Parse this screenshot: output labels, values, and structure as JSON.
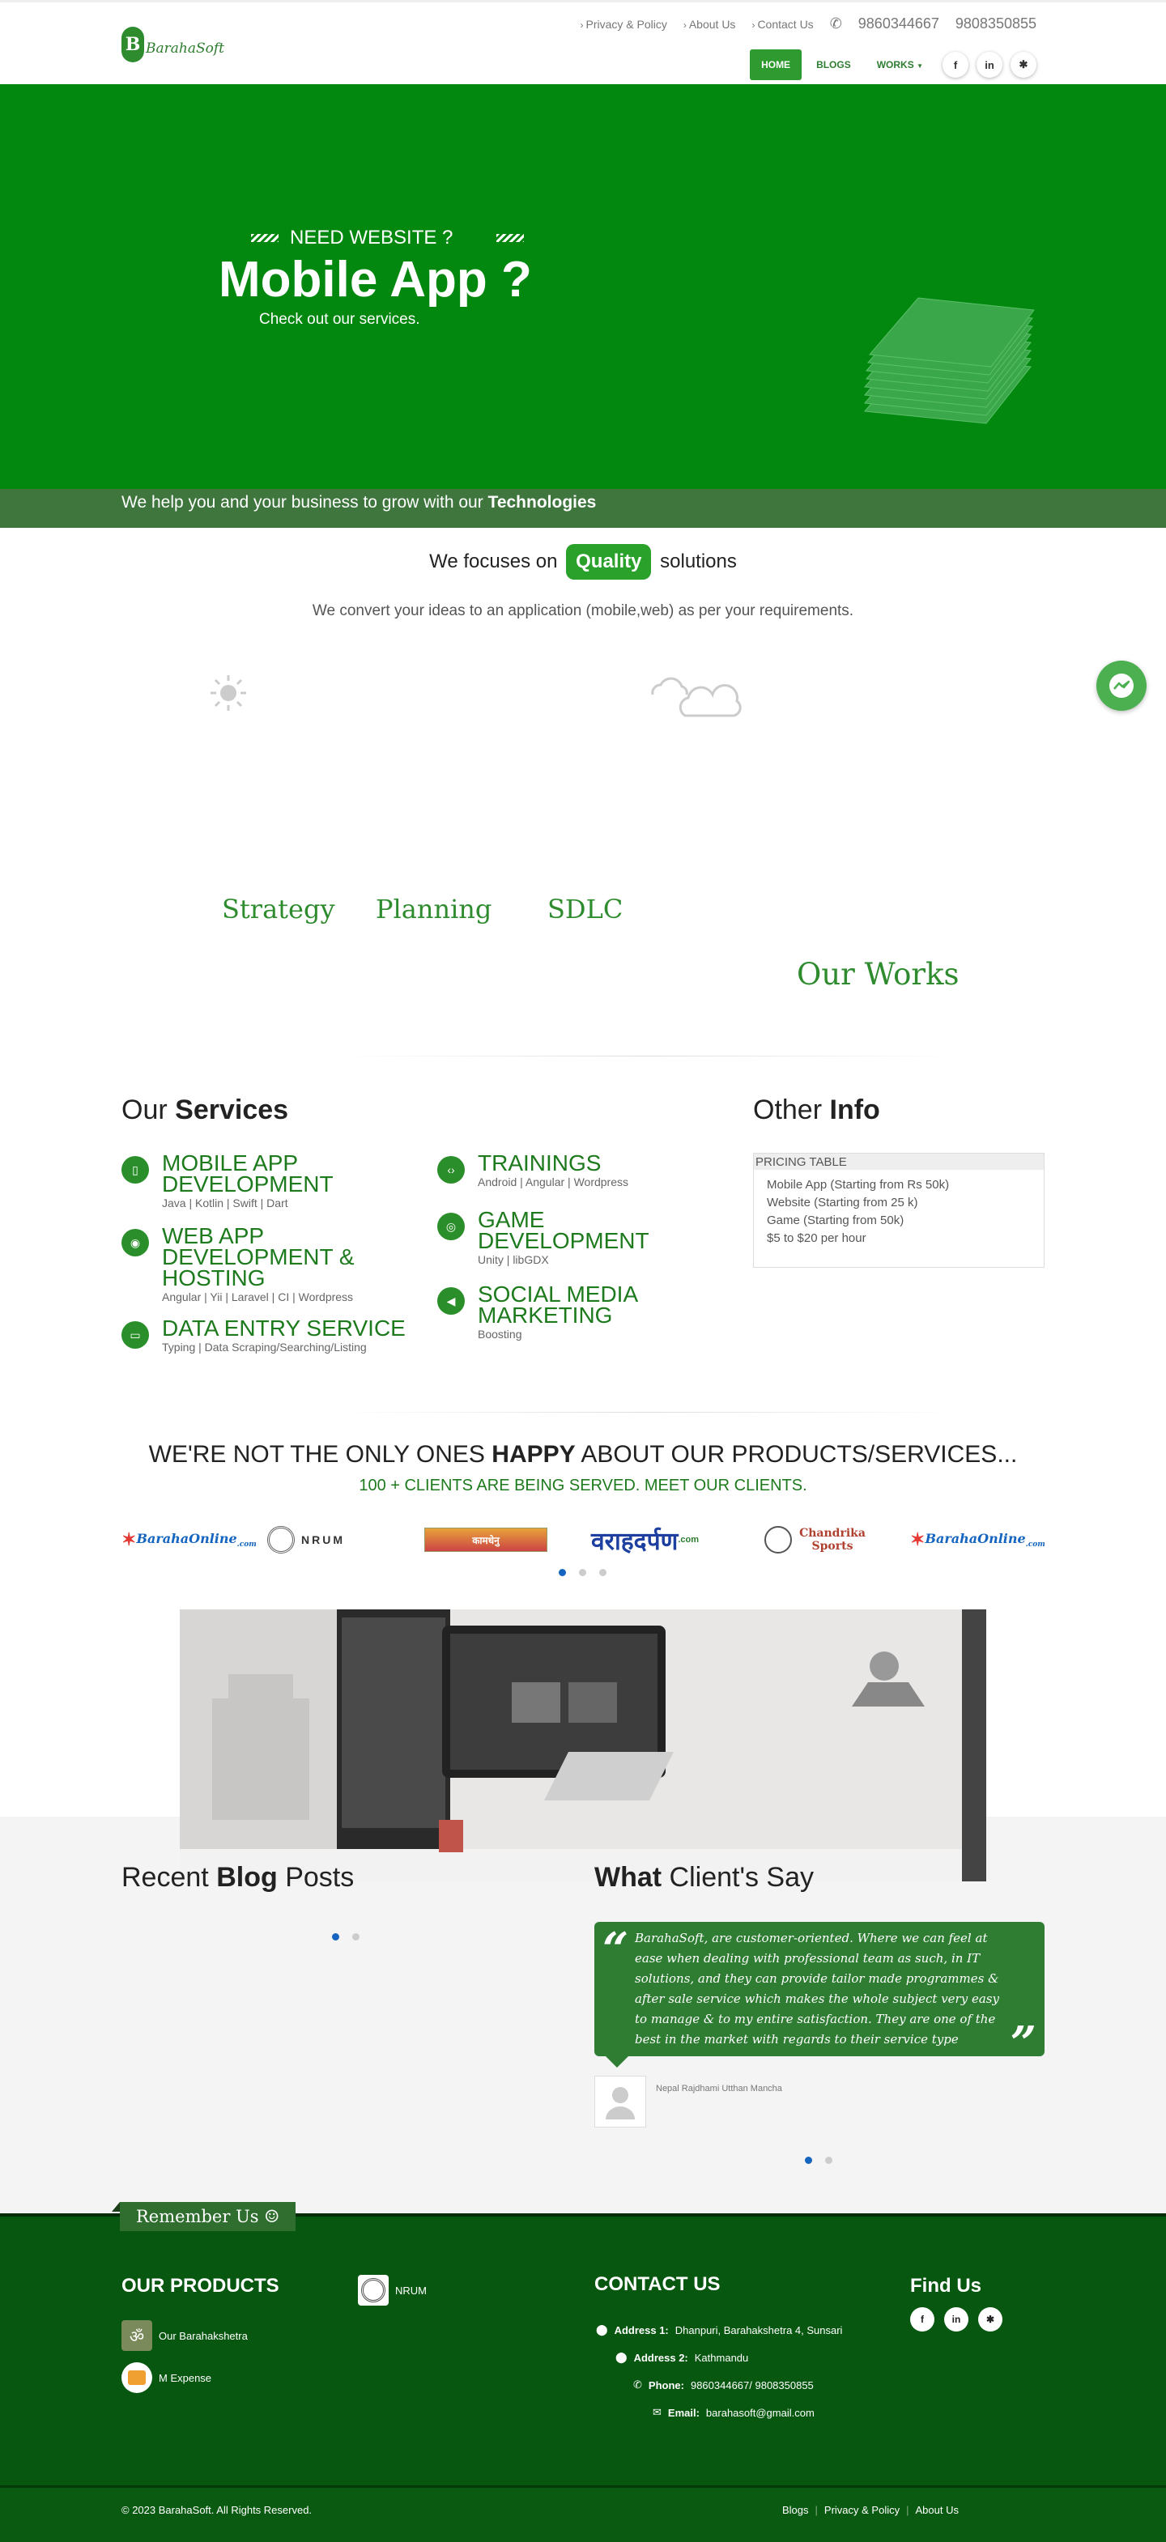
{
  "header": {
    "logo_text": "BarahaSoft",
    "logo_mark": "B",
    "top_links": [
      "Privacy & Policy",
      "About Us",
      "Contact Us"
    ],
    "phones": [
      "9860344667",
      "9808350855"
    ],
    "nav": [
      "HOME",
      "BLOGS",
      "WORKS"
    ],
    "social_icons": [
      "facebook-icon",
      "linkedin-icon",
      "android-icon"
    ],
    "social_glyphs": [
      "f",
      "in",
      "✱"
    ]
  },
  "hero": {
    "kicker": "NEED WEBSITE ?",
    "title": "Mobile App ?",
    "subtitle": "Check out our services.",
    "tagline_prefix": "We help you and your business to grow with our",
    "tagline_bold": "Technologies"
  },
  "intro": {
    "focus_prefix": "We focuses on",
    "focus_badge": "Quality",
    "focus_suffix": "solutions",
    "convert": "We convert your ideas to an application (mobile,web) as per your requirements.",
    "words": [
      "Strategy",
      "Planning",
      "SDLC"
    ],
    "our_works": "Our Works"
  },
  "services": {
    "title_light": "Our",
    "title_bold": "Services",
    "items": [
      {
        "title": "MOBILE APP DEVELOPMENT",
        "sub": "Java | Kotlin | Swift | Dart",
        "icon": "▯"
      },
      {
        "title": "WEB APP DEVELOPMENT & HOSTING",
        "sub": "Angular | Yii | Laravel | CI | Wordpress",
        "icon": "◉"
      },
      {
        "title": "DATA ENTRY SERVICE",
        "sub": "Typing | Data Scraping/Searching/Listing",
        "icon": "▭"
      },
      {
        "title": "TRAININGS",
        "sub": "Android | Angular | Wordpress",
        "icon": "‹›"
      },
      {
        "title": "GAME DEVELOPMENT",
        "sub": "Unity | libGDX",
        "icon": "◎"
      },
      {
        "title": "SOCIAL MEDIA MARKETING",
        "sub": "Boosting",
        "icon": "◀"
      }
    ]
  },
  "other_info": {
    "title_light": "Other",
    "title_bold": "Info",
    "pricing_head": "PRICING TABLE",
    "pricing": [
      "Mobile App (Starting from Rs 50k)",
      "Website (Starting from 25 k)",
      "Game (Starting from 50k)",
      "$5 to $20 per hour"
    ]
  },
  "clients": {
    "heading_prefix": "WE'RE NOT THE ONLY ONES",
    "heading_bold": "HAPPY",
    "heading_suffix": "ABOUT OUR PRODUCTS/SERVICES...",
    "sub": "100 + CLIENTS ARE BEING SERVED. MEET OUR CLIENTS.",
    "logos": [
      "BarahaOnline",
      "NRUM",
      "कामधेनु",
      "वराहदर्पण",
      "Chandrika Sports",
      "BarahaOnline"
    ],
    "logo_suffix": ".com"
  },
  "blog": {
    "title_light1": "Recent",
    "title_bold": "Blog",
    "title_light2": "Posts"
  },
  "testimonials": {
    "title_bold": "What",
    "title_light": "Client's Say",
    "quote": "BarahaSoft, are customer-oriented. Where we can feel at ease when dealing with professional team as such, in IT solutions, and they can provide tailor made programmes & after sale service which makes the whole subject very easy to manage & to my entire satisfaction. They are one of the best in the market with regards to their service type",
    "name": "Nepal Rajdhami Utthan Mancha",
    "open_mark": "“",
    "close_mark": "”"
  },
  "footer": {
    "remember": "Remember Us ☺",
    "products_title": "OUR PRODUCTS",
    "products": [
      "Our Barahakshetra",
      "M Expense",
      "NRUM"
    ],
    "contact_title": "CONTACT US",
    "contact": [
      {
        "label": "Address 1:",
        "value": "Dhanpuri, Barahakshetra 4, Sunsari"
      },
      {
        "label": "Address 2:",
        "value": "Kathmandu"
      },
      {
        "label": "Phone:",
        "value": "9860344667/ 9808350855"
      },
      {
        "label": "Email:",
        "value": "barahasoft@gmail.com"
      }
    ],
    "find_title": "Find Us",
    "copyright": "© 2023 BarahaSoft. All Rights Reserved.",
    "bottom_links": [
      "Blogs",
      "Privacy & Policy",
      "About Us"
    ]
  },
  "colors": {
    "brand_green": "#02880f",
    "dark_green": "#075710",
    "text_green": "#1d7a1d",
    "accent_blue": "#1565c0"
  }
}
